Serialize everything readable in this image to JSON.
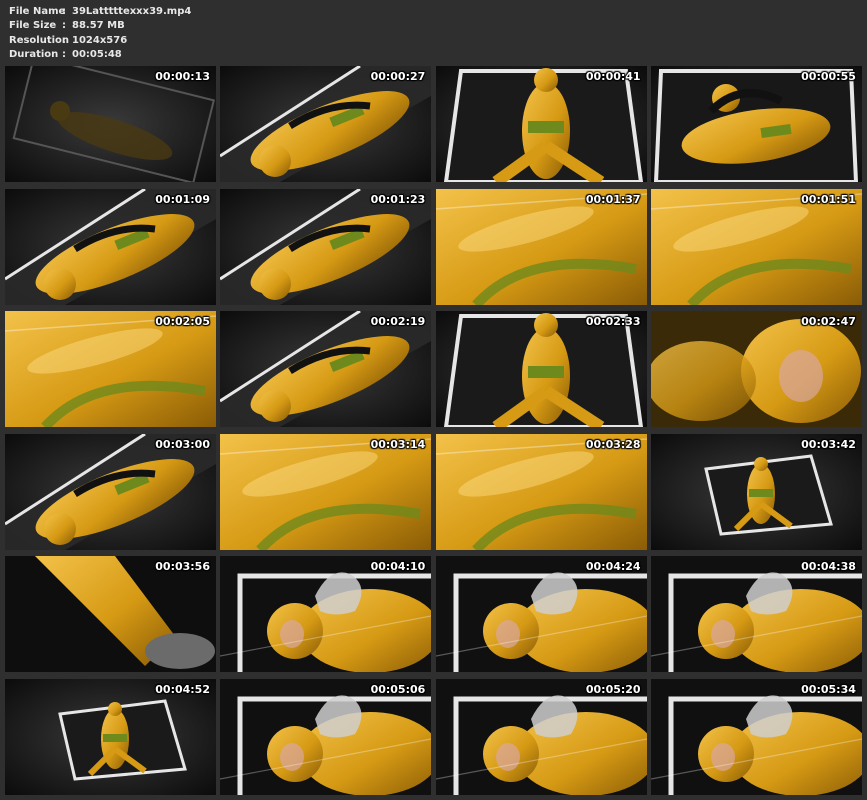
{
  "file_info": {
    "rows": [
      {
        "key": "File Name",
        "sep": ":",
        "value": "39Latttttexxx39.mp4"
      },
      {
        "key": "File Size",
        "sep": ":",
        "value": "88.57 MB"
      },
      {
        "key": "Resolution",
        "sep": ":",
        "value": "1024x576"
      },
      {
        "key": "Duration",
        "sep": ":",
        "value": "00:05:48"
      }
    ]
  },
  "thumbnails": [
    {
      "timestamp": "00:00:13",
      "scene": "dark-frame"
    },
    {
      "timestamp": "00:00:27",
      "scene": "diagonal-body"
    },
    {
      "timestamp": "00:00:41",
      "scene": "frame-overhead"
    },
    {
      "timestamp": "00:00:55",
      "scene": "frame-lying"
    },
    {
      "timestamp": "00:01:09",
      "scene": "diagonal-body"
    },
    {
      "timestamp": "00:01:23",
      "scene": "diagonal-body"
    },
    {
      "timestamp": "00:01:37",
      "scene": "closeup"
    },
    {
      "timestamp": "00:01:51",
      "scene": "closeup"
    },
    {
      "timestamp": "00:02:05",
      "scene": "closeup"
    },
    {
      "timestamp": "00:02:19",
      "scene": "diagonal-body"
    },
    {
      "timestamp": "00:02:33",
      "scene": "frame-overhead"
    },
    {
      "timestamp": "00:02:47",
      "scene": "head-closeup"
    },
    {
      "timestamp": "00:03:00",
      "scene": "diagonal-body"
    },
    {
      "timestamp": "00:03:14",
      "scene": "closeup"
    },
    {
      "timestamp": "00:03:28",
      "scene": "closeup"
    },
    {
      "timestamp": "00:03:42",
      "scene": "small-frame"
    },
    {
      "timestamp": "00:03:56",
      "scene": "foot-closeup"
    },
    {
      "timestamp": "00:04:10",
      "scene": "frame-bag"
    },
    {
      "timestamp": "00:04:24",
      "scene": "frame-bag"
    },
    {
      "timestamp": "00:04:38",
      "scene": "frame-bag"
    },
    {
      "timestamp": "00:04:52",
      "scene": "small-frame"
    },
    {
      "timestamp": "00:05:06",
      "scene": "frame-bag"
    },
    {
      "timestamp": "00:05:20",
      "scene": "frame-bag"
    },
    {
      "timestamp": "00:05:34",
      "scene": "frame-bag"
    }
  ],
  "colors": {
    "background": "#2f2f2f",
    "text": "#e8e8e8",
    "latex": "#d69a14",
    "latex_light": "#f3c24a",
    "accent_green": "#6f8a1c",
    "frame_white": "#e6e6e6",
    "dark": "#0b0b0b"
  }
}
